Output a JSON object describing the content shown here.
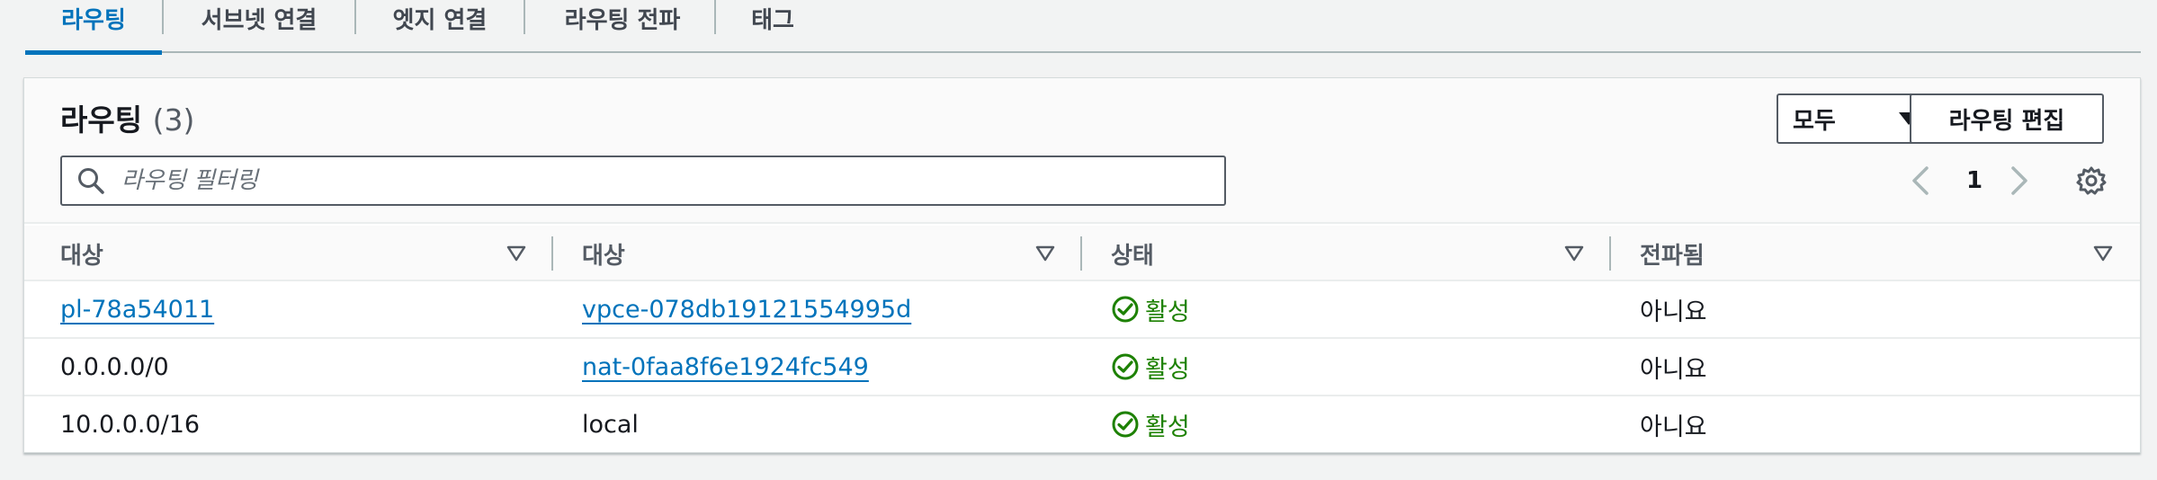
{
  "tabs": [
    {
      "label": "라우팅",
      "active": true
    },
    {
      "label": "서브넷 연결",
      "active": false
    },
    {
      "label": "엣지 연결",
      "active": false
    },
    {
      "label": "라우팅 전파",
      "active": false
    },
    {
      "label": "태그",
      "active": false
    }
  ],
  "panel": {
    "title": "라우팅",
    "count": "(3)",
    "filter_button": "모두",
    "edit_button": "라우팅 편집",
    "search_placeholder": "라우팅 필터링",
    "page_number": "1"
  },
  "table": {
    "columns": [
      "대상",
      "대상",
      "상태",
      "전파됨"
    ],
    "rows": [
      {
        "destination": "pl-78a54011",
        "destination_link": true,
        "target": "vpce-078db19121554995d",
        "target_link": true,
        "status": "활성",
        "propagated": "아니요"
      },
      {
        "destination": "0.0.0.0/0",
        "destination_link": false,
        "target": "nat-0faa8f6e1924fc549",
        "target_link": true,
        "status": "활성",
        "propagated": "아니요"
      },
      {
        "destination": "10.0.0.0/16",
        "destination_link": false,
        "target": "local",
        "target_link": false,
        "status": "활성",
        "propagated": "아니요"
      }
    ]
  },
  "colors": {
    "accent": "#0073bb",
    "success": "#1d8102",
    "text": "#16191f",
    "muted": "#545b64"
  },
  "icons": {
    "search": "search-icon",
    "sort": "sort-caret-icon",
    "status": "check-circle-icon",
    "prev": "chevron-left-icon",
    "next": "chevron-right-icon",
    "settings": "gear-icon",
    "dropdown": "caret-down-icon"
  }
}
